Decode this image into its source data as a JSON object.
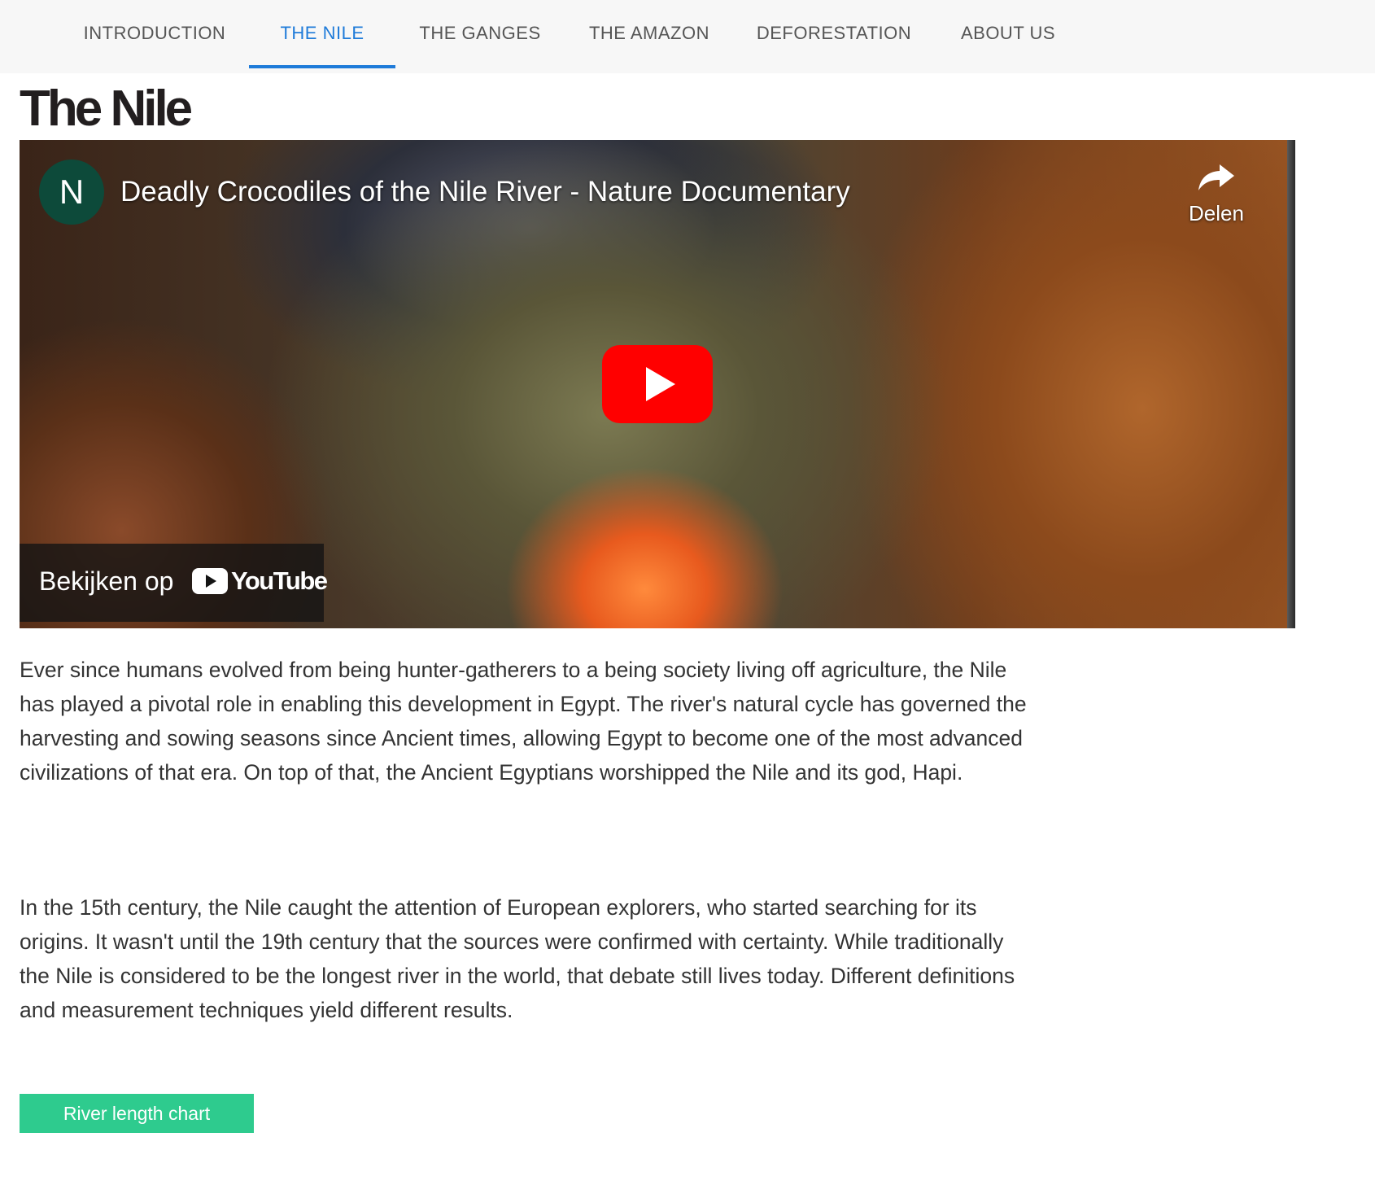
{
  "nav": {
    "items": [
      {
        "label": "INTRODUCTION",
        "active": false
      },
      {
        "label": "THE NILE",
        "active": true
      },
      {
        "label": "THE GANGES",
        "active": false
      },
      {
        "label": "THE AMAZON",
        "active": false
      },
      {
        "label": "DEFORESTATION",
        "active": false
      },
      {
        "label": "ABOUT US",
        "active": false
      }
    ],
    "active_color": "#1f7bd9"
  },
  "page": {
    "title": "The Nile"
  },
  "video": {
    "channel_initial": "N",
    "channel_color": "#0d4a3a",
    "title": "Deadly Crocodiles of the Nile River - Nature Documentary",
    "share_label": "Delen",
    "watch_on_label": "Bekijken op",
    "youtube_wordmark": "YouTube",
    "play_icon": "play-icon",
    "play_color": "#ff0000"
  },
  "content": {
    "paragraphs": [
      "Ever since humans evolved from being hunter-gatherers to a being society living off agriculture, the Nile has played a pivotal role in enabling this development in Egypt. The river's natural cycle has governed the harvesting and sowing seasons since Ancient times, allowing Egypt to become one of the most advanced civilizations of that era. On top of that, the Ancient Egyptians worshipped the Nile and its god, Hapi.",
      "In the 15th century, the Nile caught the attention of European explorers, who started searching for its origins. It wasn't until the 19th century that the sources were confirmed with certainty. While traditionally the Nile is considered to be the longest river in the world, that debate still lives today. Different definitions and measurement techniques yield different results."
    ]
  },
  "actions": {
    "chart_button_label": "River length chart",
    "chart_button_color": "#2ecb8e"
  }
}
